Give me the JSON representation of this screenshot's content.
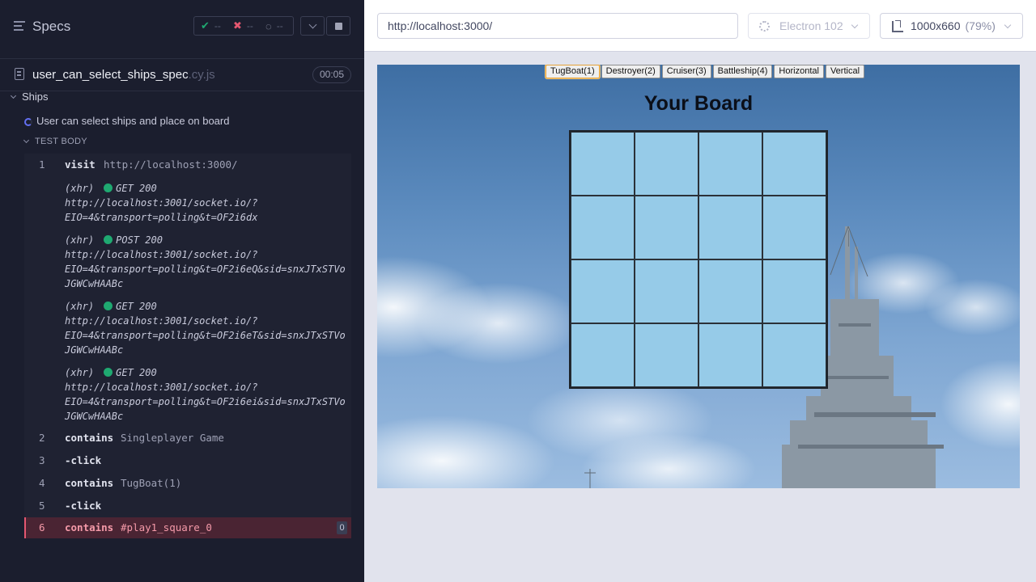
{
  "reporter": {
    "header": {
      "title": "Specs",
      "stats": {
        "passed": "--",
        "failed": "--",
        "pending": "--"
      }
    },
    "spec": {
      "name": "user_can_select_ships_spec",
      "ext": ".cy.js",
      "duration": "00:05"
    },
    "suite": "Ships",
    "test": "User can select ships and place on board",
    "body_header": "TEST BODY",
    "commands": [
      {
        "num": "1",
        "name": "visit",
        "message": "http://localhost:3000/"
      },
      {
        "num": "2",
        "name": "contains",
        "message": "Singleplayer Game"
      },
      {
        "num": "3",
        "name": "-click",
        "message": ""
      },
      {
        "num": "4",
        "name": "contains",
        "message": "TugBoat(1)"
      },
      {
        "num": "5",
        "name": "-click",
        "message": ""
      },
      {
        "num": "6",
        "name": "contains",
        "message": "#play1_square_0",
        "count": "0"
      }
    ],
    "xhr": [
      {
        "label": "(xhr)",
        "method": "GET 200",
        "url": "http://localhost:3001/socket.io/?\nEIO=4&transport=polling&t=OF2i6dx"
      },
      {
        "label": "(xhr)",
        "method": "POST 200",
        "url": "http://localhost:3001/socket.io/?\nEIO=4&transport=polling&t=OF2i6eQ&sid=snxJTxSTVo\nJGWCwHAABc"
      },
      {
        "label": "(xhr)",
        "method": "GET 200",
        "url": "http://localhost:3001/socket.io/?\nEIO=4&transport=polling&t=OF2i6eT&sid=snxJTxSTVo\nJGWCwHAABc"
      },
      {
        "label": "(xhr)",
        "method": "GET 200",
        "url": "http://localhost:3001/socket.io/?\nEIO=4&transport=polling&t=OF2i6ei&sid=snxJTxSTVo\nJGWCwHAABc"
      }
    ]
  },
  "aut": {
    "url": "http://localhost:3000/",
    "browser": "Electron 102",
    "viewport": "1000x660",
    "scale": "(79%)",
    "app": {
      "ship_buttons": [
        "TugBoat(1)",
        "Destroyer(2)",
        "Cruiser(3)",
        "Battleship(4)",
        "Horizontal",
        "Vertical"
      ],
      "board_title": "Your Board"
    }
  },
  "colors": {
    "reporter_bg": "#1b1e2e",
    "pass": "#1fa971",
    "fail": "#e45770",
    "board_cell": "#96cbe8"
  },
  "icons": [
    "specs-menu-icon",
    "check-icon",
    "x-icon",
    "spinner-icon",
    "chevron-down-icon",
    "stop-icon",
    "file-icon",
    "gear-icon",
    "ruler-icon"
  ]
}
